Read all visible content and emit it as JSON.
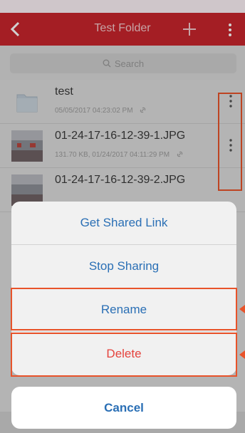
{
  "header": {
    "title": "Test Folder",
    "back_icon": "chevron-left-icon",
    "add_icon": "plus-icon",
    "more_icon": "vertical-ellipsis-icon"
  },
  "search": {
    "placeholder": "Search"
  },
  "files": [
    {
      "name": "test",
      "meta": "05/05/2017 04:23:02 PM",
      "type": "folder",
      "shared": true
    },
    {
      "name": "01-24-17-16-12-39-1.JPG",
      "meta": "131.70 KB, 01/24/2017 04:11:29 PM",
      "type": "image",
      "shared": true
    },
    {
      "name": "01-24-17-16-12-39-2.JPG",
      "meta": "",
      "type": "image",
      "shared": false
    }
  ],
  "action_sheet": {
    "items": [
      {
        "label": "Get Shared Link"
      },
      {
        "label": "Stop Sharing"
      },
      {
        "label": "Rename"
      },
      {
        "label": "Delete"
      }
    ],
    "cancel_label": "Cancel"
  },
  "colors": {
    "header": "#c8252c",
    "action_blue": "#2a6fb5",
    "delete_red": "#e5433d",
    "annotation": "#e8532a"
  }
}
